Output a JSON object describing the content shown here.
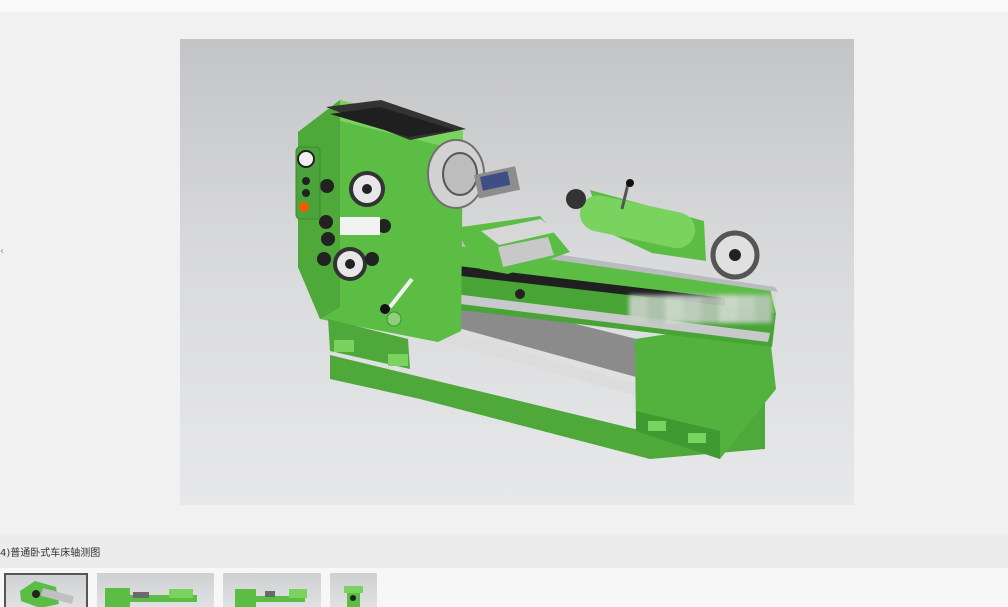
{
  "caption": {
    "text": "4)普通卧式车床轴测图"
  },
  "viewer": {
    "main_image_alt": "lathe-3d-model",
    "colors": {
      "machine_green": "#5cbd45",
      "machine_dark_green": "#3f9a31",
      "machine_light_green": "#7bd35f",
      "background_gray": "#d8d9db"
    }
  },
  "thumbnails": [
    {
      "id": "thumb-1",
      "selected": true
    },
    {
      "id": "thumb-2",
      "selected": false
    },
    {
      "id": "thumb-3",
      "selected": false
    },
    {
      "id": "thumb-4",
      "selected": false
    }
  ]
}
